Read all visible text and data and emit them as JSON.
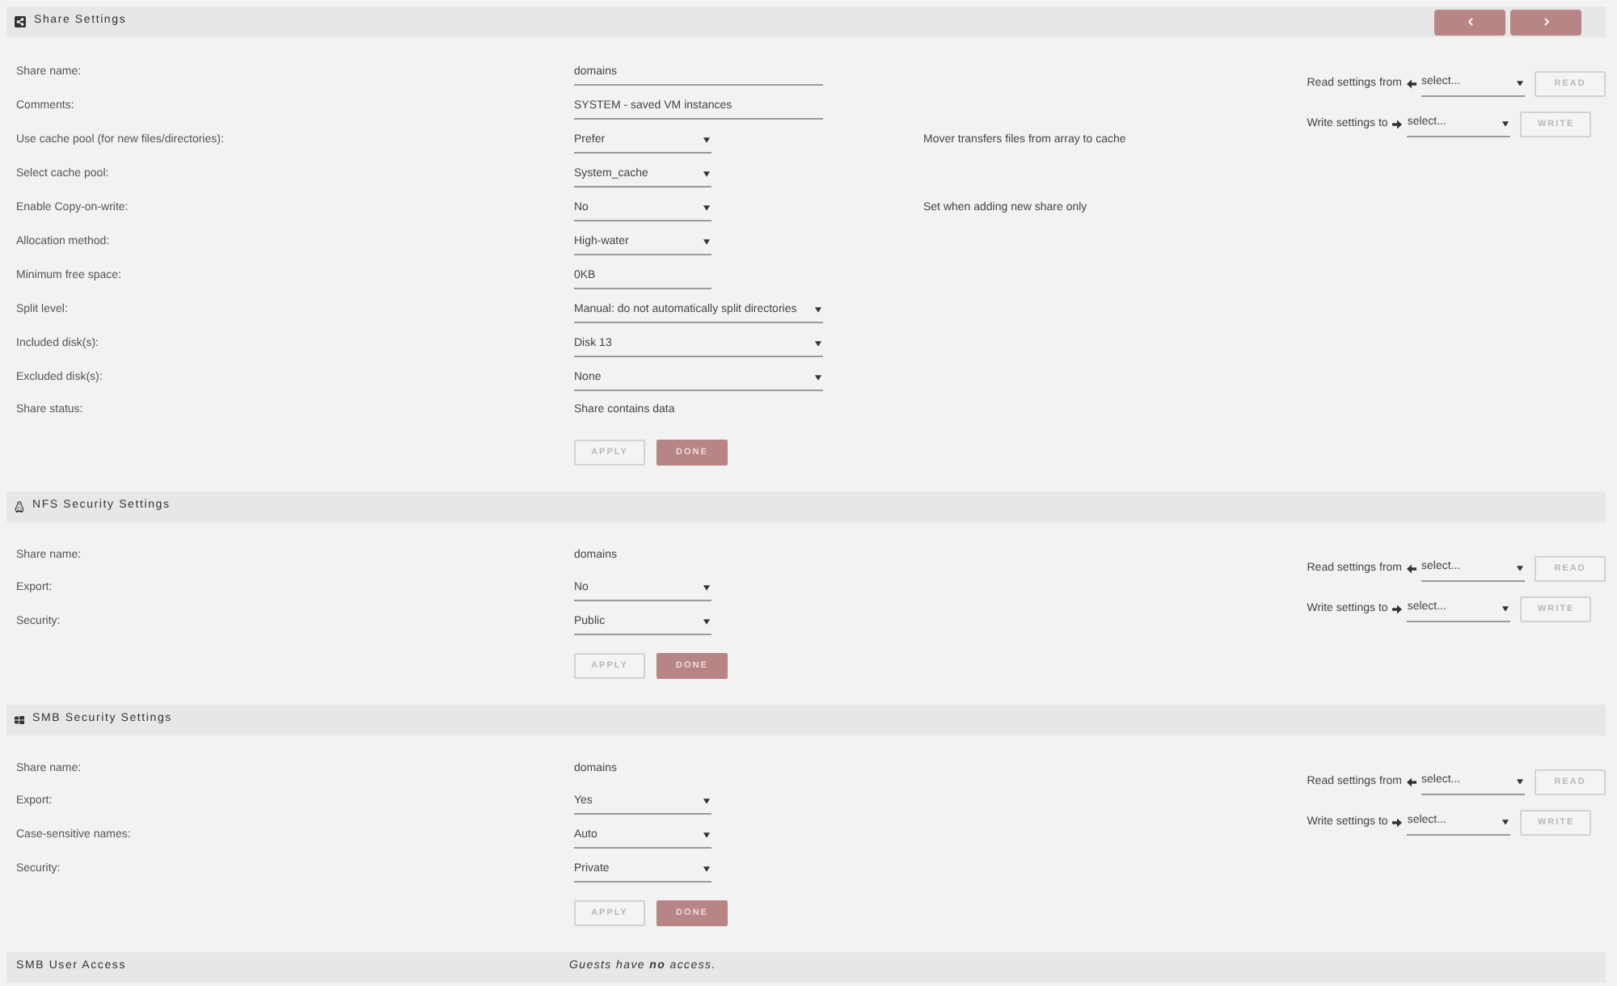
{
  "sections": [
    {
      "kind": "share",
      "title": "Share Settings",
      "rows": [
        {
          "label": "Share name:",
          "kind": "input",
          "value": "domains"
        },
        {
          "label": "Comments:",
          "kind": "input",
          "value": "SYSTEM - saved VM instances"
        },
        {
          "label": "Use cache pool (for new files/directories):",
          "kind": "select",
          "value": "Prefer",
          "hint": "Mover transfers files from array to cache"
        },
        {
          "label": "Select cache pool:",
          "kind": "select",
          "value": "System_cache"
        },
        {
          "label": "Enable Copy-on-write:",
          "kind": "select",
          "value": "No",
          "hint": "Set when adding new share only"
        },
        {
          "label": "Allocation method:",
          "kind": "select",
          "value": "High-water"
        },
        {
          "label": "Minimum free space:",
          "kind": "shortinput",
          "value": "0KB"
        },
        {
          "label": "Split level:",
          "kind": "wideselect",
          "value": "Manual: do not automatically split directories"
        },
        {
          "label": "Included disk(s):",
          "kind": "wideselect",
          "value": "Disk 13"
        },
        {
          "label": "Excluded disk(s):",
          "kind": "wideselect",
          "value": "None"
        },
        {
          "label": "Share status:",
          "kind": "text",
          "value": "Share contains data"
        }
      ],
      "buttons": [
        {
          "label": "APPLY",
          "disabled": true
        },
        {
          "label": "DONE",
          "disabled": false
        }
      ],
      "copy": [
        {
          "kind": "read",
          "label": "Read settings from",
          "value": "select...",
          "button": "READ",
          "disabled": true
        },
        {
          "kind": "write",
          "label": "Write settings to",
          "value": "select...",
          "button": "WRITE",
          "disabled": true
        }
      ]
    },
    {
      "kind": "nfs",
      "title": "NFS Security Settings",
      "rows": [
        {
          "label": "Share name:",
          "kind": "text",
          "value": "domains"
        },
        {
          "label": "Export:",
          "kind": "select",
          "value": "No"
        },
        {
          "label": "Security:",
          "kind": "select",
          "value": "Public"
        }
      ],
      "buttons": [
        {
          "label": "APPLY",
          "disabled": true
        },
        {
          "label": "DONE",
          "disabled": false
        }
      ],
      "copy": [
        {
          "kind": "read",
          "label": "Read settings from",
          "value": "select...",
          "button": "READ",
          "disabled": true
        },
        {
          "kind": "write",
          "label": "Write settings to",
          "value": "select...",
          "button": "WRITE",
          "disabled": true
        }
      ]
    },
    {
      "kind": "smb",
      "title": "SMB Security Settings",
      "rows": [
        {
          "label": "Share name:",
          "kind": "text",
          "value": "domains"
        },
        {
          "label": "Export:",
          "kind": "select",
          "value": "Yes"
        },
        {
          "label": "Case-sensitive names:",
          "kind": "select",
          "value": "Auto"
        },
        {
          "label": "Security:",
          "kind": "select",
          "value": "Private"
        }
      ],
      "buttons": [
        {
          "label": "APPLY",
          "disabled": true
        },
        {
          "label": "DONE",
          "disabled": false
        }
      ],
      "copy": [
        {
          "kind": "read",
          "label": "Read settings from",
          "value": "select...",
          "button": "READ",
          "disabled": true
        },
        {
          "kind": "write",
          "label": "Write settings to",
          "value": "select...",
          "button": "WRITE",
          "disabled": true
        }
      ]
    }
  ],
  "user_access": {
    "title": "SMB User Access",
    "note": "Guests have **no** access."
  }
}
